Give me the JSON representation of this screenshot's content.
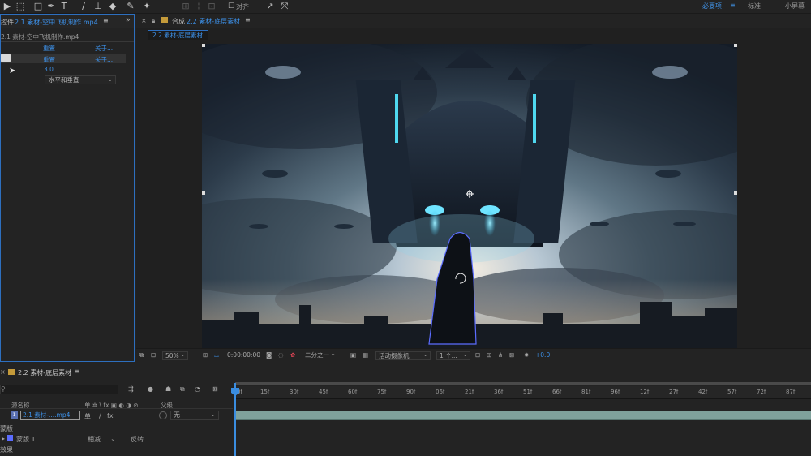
{
  "toolbar": {
    "snap_label": "对齐",
    "workspaces": [
      {
        "label": "必要项",
        "active": true
      },
      {
        "label": "标准",
        "active": false
      },
      {
        "label": "小屏幕",
        "active": false
      }
    ],
    "tools": [
      "video-camera-icon",
      "select-icon",
      "rect-shape-icon",
      "pen-icon",
      "type-icon",
      "brush-icon",
      "stamp-icon",
      "eraser-icon",
      "roto-icon",
      "pin-icon",
      "orbit-icon",
      "move-icon",
      "snap-checkbox-icon",
      "expand-icon"
    ]
  },
  "effect_panel": {
    "tab_prefix": "控件",
    "tab_title": "2.1 素材-空中飞机制作.mp4",
    "layer_name": "2.1 素材-空中飞机制作.mp4",
    "rows": [
      {
        "value": "重置",
        "link": "关于..."
      },
      {
        "value": "重置",
        "link": "关于..."
      }
    ],
    "number_value": "3.0",
    "dropdown_value": "水平和垂直"
  },
  "viewer": {
    "tab_prefix": "合成",
    "tab_title": "2.2 素材-底层素材",
    "crumb": "2.2 素材-底层素材",
    "zoom": "50%",
    "timecode": "0:00:00:00",
    "resolution": "二分之一",
    "camera": "活动摄像机",
    "views": "1 个...",
    "exposure": "+0.0"
  },
  "timeline": {
    "tab_title": "2.2 素材-底层素材",
    "search_placeholder": "",
    "col_source": "源名称",
    "col_switches": "单 ✲ \\ fx ▣ ◐ ◑ ⊘",
    "col_parent": "父级",
    "layer_index": "1",
    "layer_name": "2.1 素材-....mp4",
    "parent_value": "无",
    "mask_label": "蒙版",
    "mask_name": "蒙版 1",
    "mask_mode": "相减",
    "mask_invert": "反转",
    "effects_label": "效果",
    "ruler_ticks": [
      "0f",
      "15f",
      "30f",
      "45f",
      "60f",
      "75f",
      "90f",
      "06f",
      "21f",
      "36f",
      "51f",
      "66f",
      "81f",
      "96f",
      "12f",
      "27f",
      "42f",
      "57f",
      "72f",
      "87f"
    ]
  },
  "colors": {
    "accent": "#3c8fe6",
    "panel_bg": "#232323",
    "layer_bar": "#7fa29c"
  }
}
